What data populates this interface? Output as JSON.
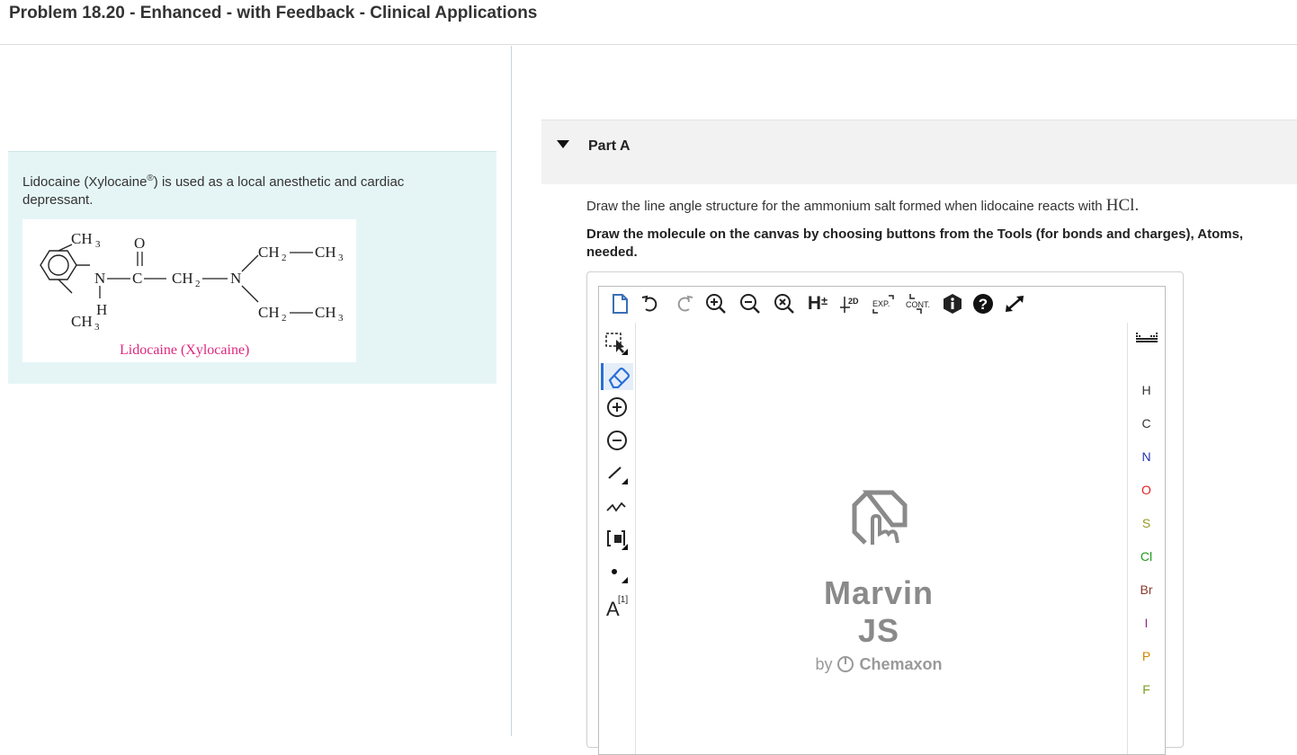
{
  "header": {
    "title": "Problem 18.20 - Enhanced - with Feedback - Clinical Applications"
  },
  "intro": {
    "text_before": "Lidocaine (Xylocaine",
    "reg": "®",
    "text_after": ") is used as a local anesthetic and cardiac depressant.",
    "caption": "Lidocaine (Xylocaine)"
  },
  "part": {
    "title": "Part A",
    "question": "Draw the line angle structure for the ammonium salt formed when lidocaine reacts with ",
    "reagent": "HCl.",
    "instruction_line1": "Draw the molecule on the canvas by choosing buttons from the Tools (for bonds and charges), Atoms,",
    "instruction_line2": "needed."
  },
  "editor": {
    "toolbar": {
      "h_label": "H",
      "h_plusminus": "±",
      "label_2d": "2D",
      "exp_label": "EXP.",
      "cont_label": "CONT."
    },
    "watermark": {
      "title": "Marvin JS",
      "by": "by",
      "brand": "Chemaxon"
    },
    "left_tools": {
      "label_a": "A",
      "label_1": "[1]"
    },
    "atoms": [
      {
        "symbol": "H",
        "color": "#333333"
      },
      {
        "symbol": "C",
        "color": "#333333"
      },
      {
        "symbol": "N",
        "color": "#2233aa"
      },
      {
        "symbol": "O",
        "color": "#dd2222"
      },
      {
        "symbol": "S",
        "color": "#999922"
      },
      {
        "symbol": "Cl",
        "color": "#1e9a1e"
      },
      {
        "symbol": "Br",
        "color": "#8a3a2a"
      },
      {
        "symbol": "I",
        "color": "#8a2a8a"
      },
      {
        "symbol": "P",
        "color": "#d08a00"
      },
      {
        "symbol": "F",
        "color": "#7aa020"
      }
    ]
  },
  "structure_labels": {
    "ch3_top": "CH",
    "sub3": "3",
    "o_top": "O",
    "n_left": "N",
    "c_carbonyl": "C",
    "ch2": "CH",
    "sub2": "2",
    "n_right": "N",
    "ch2_ch3_top_a": "CH",
    "ch2_ch3_top_b": "CH",
    "ch2_ch3_bot_a": "CH",
    "ch2_ch3_bot_b": "CH",
    "ch3_bottom": "CH",
    "h_nh": "H"
  }
}
